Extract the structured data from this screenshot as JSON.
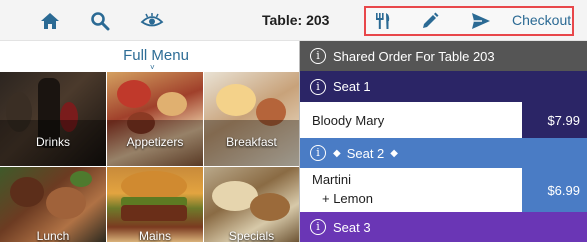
{
  "topbar": {
    "table_label": "Table: 203",
    "checkout_label": "Checkout",
    "icons": [
      "home-icon",
      "search-icon",
      "eye-icon",
      "fork-knife-icon",
      "pencil-icon",
      "send-icon"
    ]
  },
  "menu": {
    "title": "Full Menu",
    "chevron": "˅",
    "categories": [
      "Drinks",
      "Appetizers",
      "Breakfast",
      "Lunch",
      "Mains",
      "Specials"
    ]
  },
  "order": {
    "header": "Shared Order For Table 203",
    "seats": [
      {
        "label": "Seat 1",
        "items": [
          {
            "name": "Bloody Mary",
            "price": "$7.99"
          }
        ]
      },
      {
        "label": "Seat 2",
        "items": [
          {
            "name": "Martini",
            "modifier": "+ Lemon",
            "price": "$6.99"
          }
        ]
      },
      {
        "label": "Seat 3",
        "items": []
      }
    ]
  },
  "colors": {
    "accent_text": "#2b6a94",
    "checkout_border": "#e8474a",
    "shared_header": "#555555",
    "seat1": "#2b2566",
    "seat2": "#4a7cc5",
    "seat3": "#6a36b5"
  }
}
